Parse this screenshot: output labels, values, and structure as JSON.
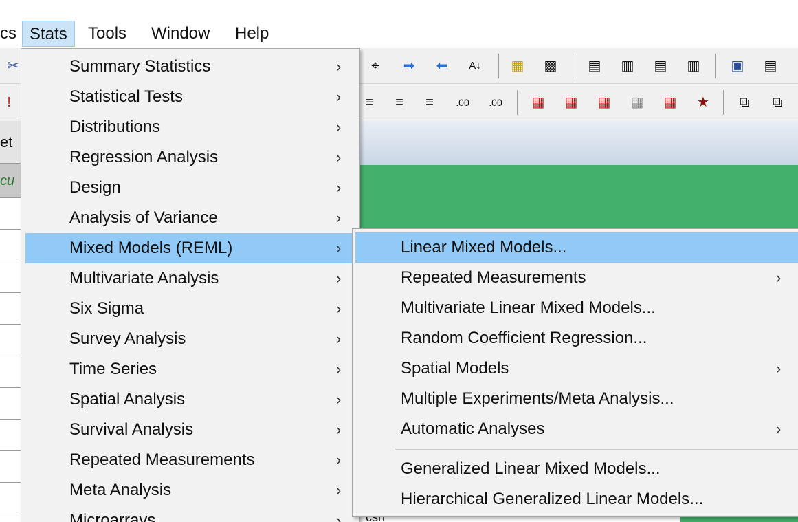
{
  "menubar": {
    "items": [
      {
        "label": "cs"
      },
      {
        "label": "Stats"
      },
      {
        "label": "Tools"
      },
      {
        "label": "Window"
      },
      {
        "label": "Help"
      }
    ]
  },
  "background": {
    "left_col_texts": [
      "et",
      "cu"
    ],
    "strip_text": "csh"
  },
  "stats_menu": {
    "items": [
      {
        "label": "Summary Statistics"
      },
      {
        "label": "Statistical Tests"
      },
      {
        "label": "Distributions"
      },
      {
        "label": "Regression Analysis"
      },
      {
        "label": "Design"
      },
      {
        "label": "Analysis of Variance"
      },
      {
        "label": "Mixed Models (REML)",
        "highlighted": true
      },
      {
        "label": "Multivariate Analysis"
      },
      {
        "label": "Six Sigma"
      },
      {
        "label": "Survey Analysis"
      },
      {
        "label": "Time Series"
      },
      {
        "label": "Spatial Analysis"
      },
      {
        "label": "Survival Analysis"
      },
      {
        "label": "Repeated Measurements"
      },
      {
        "label": "Meta Analysis"
      },
      {
        "label": "Microarrays"
      }
    ],
    "submenu_arrow": "›"
  },
  "mixed_models_submenu": {
    "items": [
      {
        "label": "Linear Mixed Models...",
        "highlighted": true
      },
      {
        "label": "Repeated Measurements",
        "has_submenu": true
      },
      {
        "label": "Multivariate Linear Mixed Models..."
      },
      {
        "label": "Random Coefficient Regression..."
      },
      {
        "label": "Spatial Models",
        "has_submenu": true
      },
      {
        "label": "Multiple Experiments/Meta Analysis..."
      },
      {
        "label": "Automatic Analyses",
        "has_submenu": true
      },
      {
        "label": "Generalized Linear Mixed Models..."
      },
      {
        "label": "Hierarchical Generalized Linear Models..."
      }
    ]
  },
  "colors": {
    "highlight": "#91c9f7",
    "menu_bg": "#f2f2f2",
    "green_pane": "#43b06c",
    "menubar_active": "#cce4f7"
  }
}
